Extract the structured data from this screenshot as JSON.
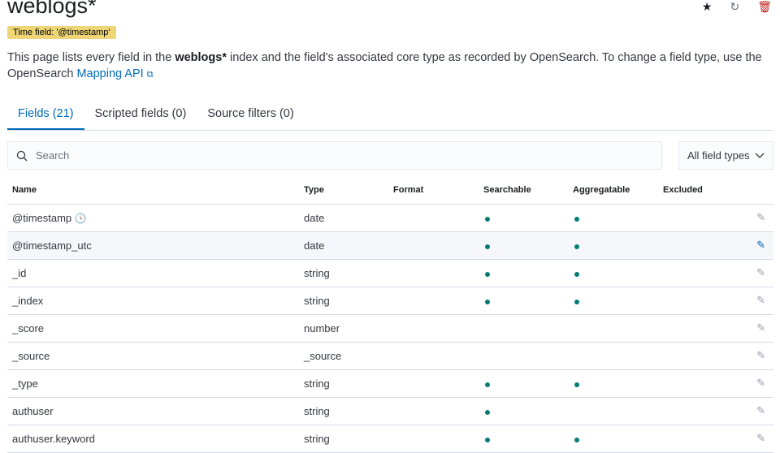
{
  "header": {
    "title": "weblogs*",
    "time_badge": "Time field: '@timestamp'"
  },
  "description": {
    "pre": "This page lists every field in the ",
    "index": "weblogs*",
    "post": " index and the field's associated core type as recorded by OpenSearch. To change a field type, use the OpenSearch ",
    "link": "Mapping API"
  },
  "actions": {
    "favorite": "star-icon",
    "refresh": "refresh-icon",
    "delete": "trash-icon"
  },
  "tabs": [
    {
      "label": "Fields (21)"
    },
    {
      "label": "Scripted fields (0)"
    },
    {
      "label": "Source filters (0)"
    }
  ],
  "search": {
    "placeholder": "Search"
  },
  "filter": {
    "value": "All field types"
  },
  "columns": [
    "Name",
    "Type",
    "Format",
    "Searchable",
    "Aggregatable",
    "Excluded"
  ],
  "rows": [
    {
      "name": "@timestamp",
      "type": "date",
      "searchable": true,
      "aggregatable": true,
      "time": true
    },
    {
      "name": "@timestamp_utc",
      "type": "date",
      "searchable": true,
      "aggregatable": true
    },
    {
      "name": "_id",
      "type": "string",
      "searchable": true,
      "aggregatable": true
    },
    {
      "name": "_index",
      "type": "string",
      "searchable": true,
      "aggregatable": true
    },
    {
      "name": "_score",
      "type": "number",
      "searchable": false,
      "aggregatable": false
    },
    {
      "name": "_source",
      "type": "_source",
      "searchable": false,
      "aggregatable": false
    },
    {
      "name": "_type",
      "type": "string",
      "searchable": true,
      "aggregatable": true
    },
    {
      "name": "authuser",
      "type": "string",
      "searchable": true,
      "aggregatable": false
    },
    {
      "name": "authuser.keyword",
      "type": "string",
      "searchable": true,
      "aggregatable": true
    }
  ],
  "colors": {
    "accent": "#006bb8",
    "dot": "#017d73",
    "danger": "#bd271e",
    "badge": "#eed575"
  }
}
